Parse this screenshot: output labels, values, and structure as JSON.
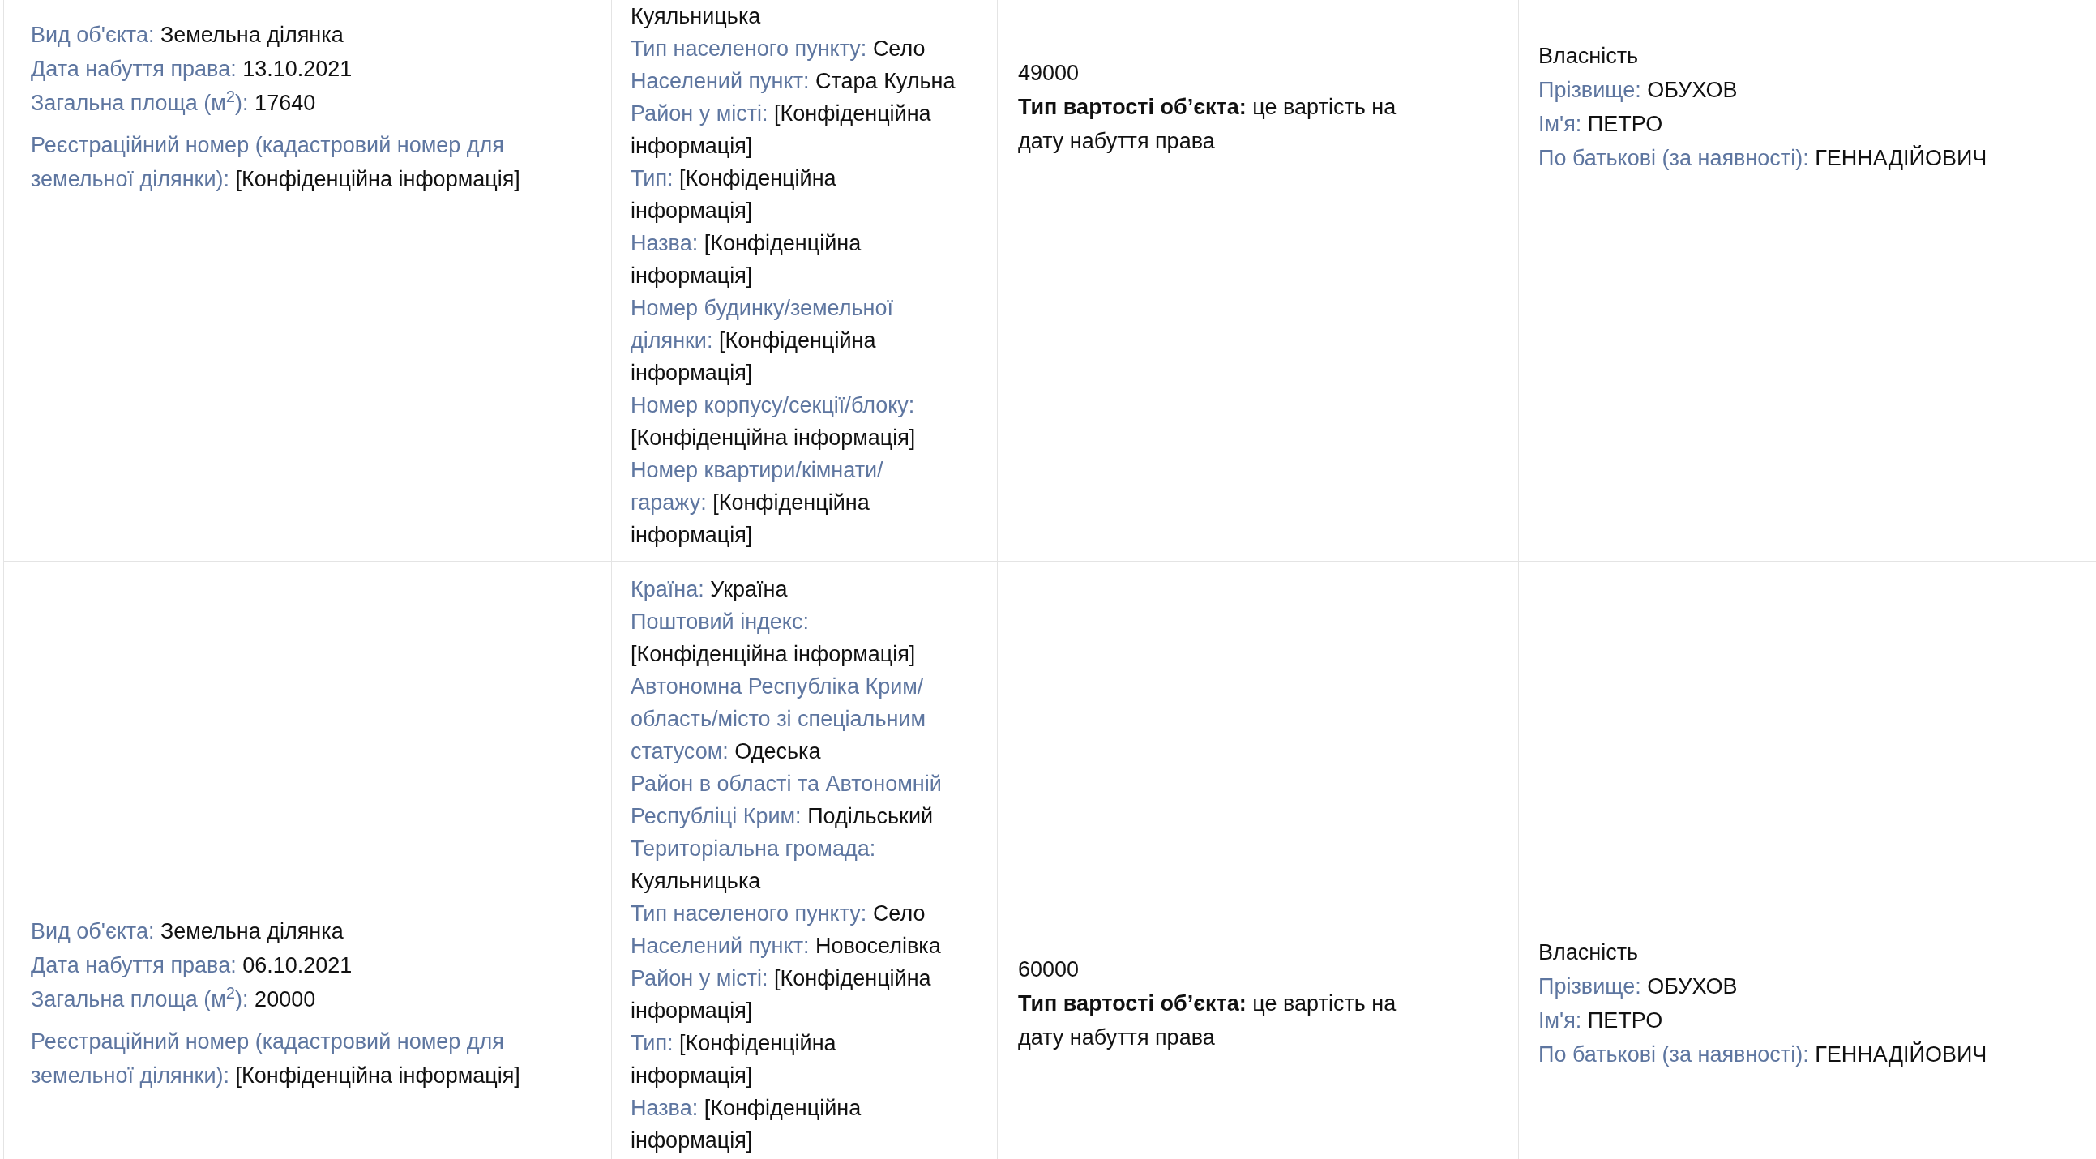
{
  "rows": [
    {
      "object": {
        "fields": [
          {
            "label": "Вид об'єкта:",
            "value": "Земельна ділянка"
          },
          {
            "label": "Дата набуття права:",
            "value": "13.10.2021"
          },
          {
            "label": "Загальна площа (м$^{2}$):",
            "value": "17640"
          }
        ],
        "registration": {
          "label": "Реєстраційний номер (кадастровий номер для земельної ділянки):",
          "value": "[Конфіденційна інформація]"
        }
      },
      "address": [
        {
          "text": "Куяльницька"
        },
        {
          "name": "Тип населеного пункту:",
          "text": "Село"
        },
        {
          "name": "Населений пункт:",
          "text": "Стара Кульна"
        },
        {
          "name": "Район у місті:",
          "text": "[Конфіденційна інформація]"
        },
        {
          "name": "Тип:",
          "text": "[Конфіденційна інформація]"
        },
        {
          "name": "Назва:",
          "text": "[Конфіденційна інформація]"
        },
        {
          "name": "Номер будинку/земельної ділянки:",
          "text": "[Конфіденційна інформація]"
        },
        {
          "name": "Номер корпусу/секції/блоку:",
          "text": "[Конфіденційна інформація]"
        },
        {
          "name": "Номер квартири/кімнати/гаражу:",
          "text": "[Конфіденційна інформація]"
        }
      ],
      "cost": {
        "amount": "49000",
        "type": {
          "label": "Тип вартості об’єкта:",
          "value": "це вартість на дату набуття права"
        }
      },
      "rights": {
        "type": "Власність",
        "fields": [
          {
            "label": "Прізвище:",
            "value": "ОБУХОВ"
          },
          {
            "label": "Ім'я:",
            "value": "ПЕТРО"
          },
          {
            "label": "По батькові (за наявності):",
            "value": "ГЕННАДІЙОВИЧ"
          }
        ]
      }
    },
    {
      "object": {
        "fields": [
          {
            "label": "Вид об'єкта:",
            "value": "Земельна ділянка"
          },
          {
            "label": "Дата набуття права:",
            "value": "06.10.2021"
          },
          {
            "label": "Загальна площа (м$^{2}$):",
            "value": "20000"
          }
        ],
        "registration": {
          "label": "Реєстраційний номер (кадастровий номер для земельної ділянки):",
          "value": "[Конфіденційна інформація]"
        }
      },
      "address": [
        {
          "name": "Країна:",
          "text": "Україна"
        },
        {
          "name": "Поштовий індекс:",
          "text": "[Конфіденційна інформація]"
        },
        {
          "name": "Автономна Республіка Крим/область/місто зі спеціальним статусом:",
          "text": "Одеська"
        },
        {
          "name": "Район в області та Автономній Республіці Крим:",
          "text": "Подільський"
        },
        {
          "name": "Територіальна громада:",
          "text": "Куяльницька"
        },
        {
          "name": "Тип населеного пункту:",
          "text": "Село"
        },
        {
          "name": "Населений пункт:",
          "text": "Новоселівка"
        },
        {
          "name": "Район у місті:",
          "text": "[Конфіденційна інформація]"
        },
        {
          "name": "Тип:",
          "text": "[Конфіденційна інформація]"
        },
        {
          "name": "Назва:",
          "text": "[Конфіденційна інформація]"
        }
      ],
      "cost": {
        "amount": "60000",
        "type": {
          "label": "Тип вартості об’єкта:",
          "value": "це вартість на дату набуття права"
        }
      },
      "rights": {
        "type": "Власність",
        "fields": [
          {
            "label": "Прізвище:",
            "value": "ОБУХОВ"
          },
          {
            "label": "Ім'я:",
            "value": "ПЕТРО"
          },
          {
            "label": "По батькові (за наявності):",
            "value": "ГЕННАДІЙОВИЧ"
          }
        ]
      }
    }
  ]
}
